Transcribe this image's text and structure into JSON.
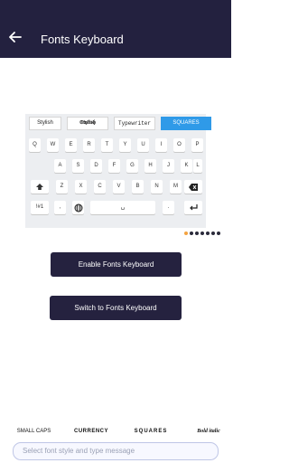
{
  "header": {
    "title": "Fonts Keyboard",
    "back_icon": "arrow-left-icon"
  },
  "preview": {
    "style_chips": [
      {
        "label": "Stylish"
      },
      {
        "label": "Typewriter"
      },
      {
        "label": "Typewriter"
      },
      {
        "label": "SQUARES"
      }
    ],
    "rows": [
      [
        "Q",
        "W",
        "E",
        "R",
        "T",
        "Y",
        "U",
        "I",
        "O",
        "P"
      ],
      [
        "A",
        "S",
        "D",
        "F",
        "G",
        "H",
        "J",
        "K",
        "L"
      ],
      [
        "Z",
        "X",
        "C",
        "V",
        "B",
        "N",
        "M"
      ],
      [
        "!#1",
        ",",
        ".",
        "⏎"
      ]
    ],
    "shift_icon": "shift-icon",
    "backspace_icon": "backspace-icon",
    "globe_icon": "globe-icon"
  },
  "actions": {
    "enable_label": "Enable Fonts Keyboard",
    "switch_label": "Switch to Fonts Keyboard"
  },
  "font_bar": {
    "chips": [
      "SMALL CAPS",
      "CURRENCY",
      "SQUARES",
      "Bold italic"
    ],
    "input_placeholder": "Select font style and type message"
  },
  "colors": {
    "primary": "#23213f",
    "accent_blue": "#2f9ae8",
    "accent_orange": "#f4a340"
  }
}
